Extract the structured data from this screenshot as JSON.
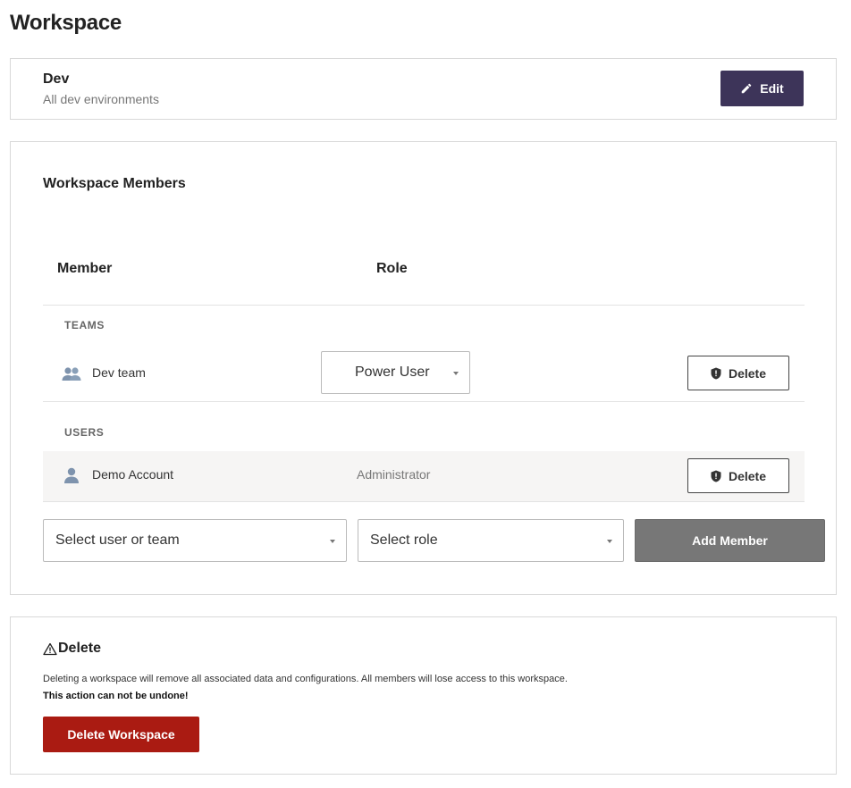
{
  "page": {
    "title": "Workspace"
  },
  "workspace": {
    "name": "Dev",
    "description": "All dev environments",
    "edit_label": "Edit",
    "accent_color": "#3d3459"
  },
  "members": {
    "title": "Workspace Members",
    "columns": {
      "member": "Member",
      "role": "Role"
    },
    "teams_label": "TEAMS",
    "users_label": "USERS",
    "teams": [
      {
        "name": "Dev team",
        "icon": "team-icon",
        "role": "Power User",
        "delete_label": "Delete"
      }
    ],
    "users": [
      {
        "name": "Demo Account",
        "icon": "user-icon",
        "role": "Administrator",
        "delete_label": "Delete"
      }
    ],
    "add": {
      "member_select": "Select user or team",
      "role_select": "Select role",
      "button_label": "Add Member"
    }
  },
  "danger": {
    "title": "Delete",
    "icon": "warning-icon",
    "description": "Deleting a workspace will remove all associated data and configurations. All members will lose access to this workspace.",
    "warning": "This action can not be undone!",
    "button_label": "Delete Workspace",
    "button_color": "#aa1b12"
  }
}
